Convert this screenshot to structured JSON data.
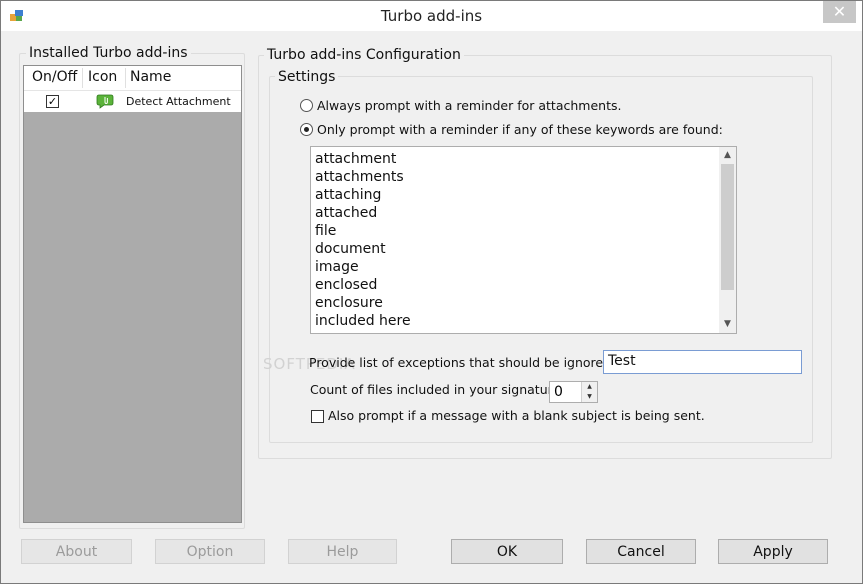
{
  "window": {
    "title": "Turbo add-ins",
    "close_glyph": "✕"
  },
  "installed": {
    "legend": "Installed Turbo add-ins",
    "columns": [
      "On/Off",
      "Icon",
      "Name"
    ],
    "rows": [
      {
        "enabled": true,
        "icon": "attachment-bubble-icon",
        "name": "Detect Attachment"
      }
    ]
  },
  "config": {
    "legend": "Turbo add-ins Configuration",
    "settings_legend": "Settings",
    "radio_always": "Always prompt with a reminder for attachments.",
    "radio_only": "Only prompt with a reminder if any of these keywords are found:",
    "selected_radio": "only",
    "keywords": [
      "attachment",
      "attachments",
      "attaching",
      "attached",
      "file",
      "document",
      "image",
      "enclosed",
      "enclosure",
      "included here"
    ],
    "exceptions_label": "Provide list of exceptions that should be ignored :",
    "exceptions_value": "Test",
    "count_label": "Count of files included in your signature:",
    "count_value": "0",
    "blank_subject_label": "Also prompt if a message with a blank subject is being sent.",
    "blank_subject_checked": false
  },
  "buttons": {
    "about": "About",
    "option": "Option",
    "help": "Help",
    "ok": "OK",
    "cancel": "Cancel",
    "apply": "Apply"
  },
  "watermark": "SOFTPEDIA"
}
